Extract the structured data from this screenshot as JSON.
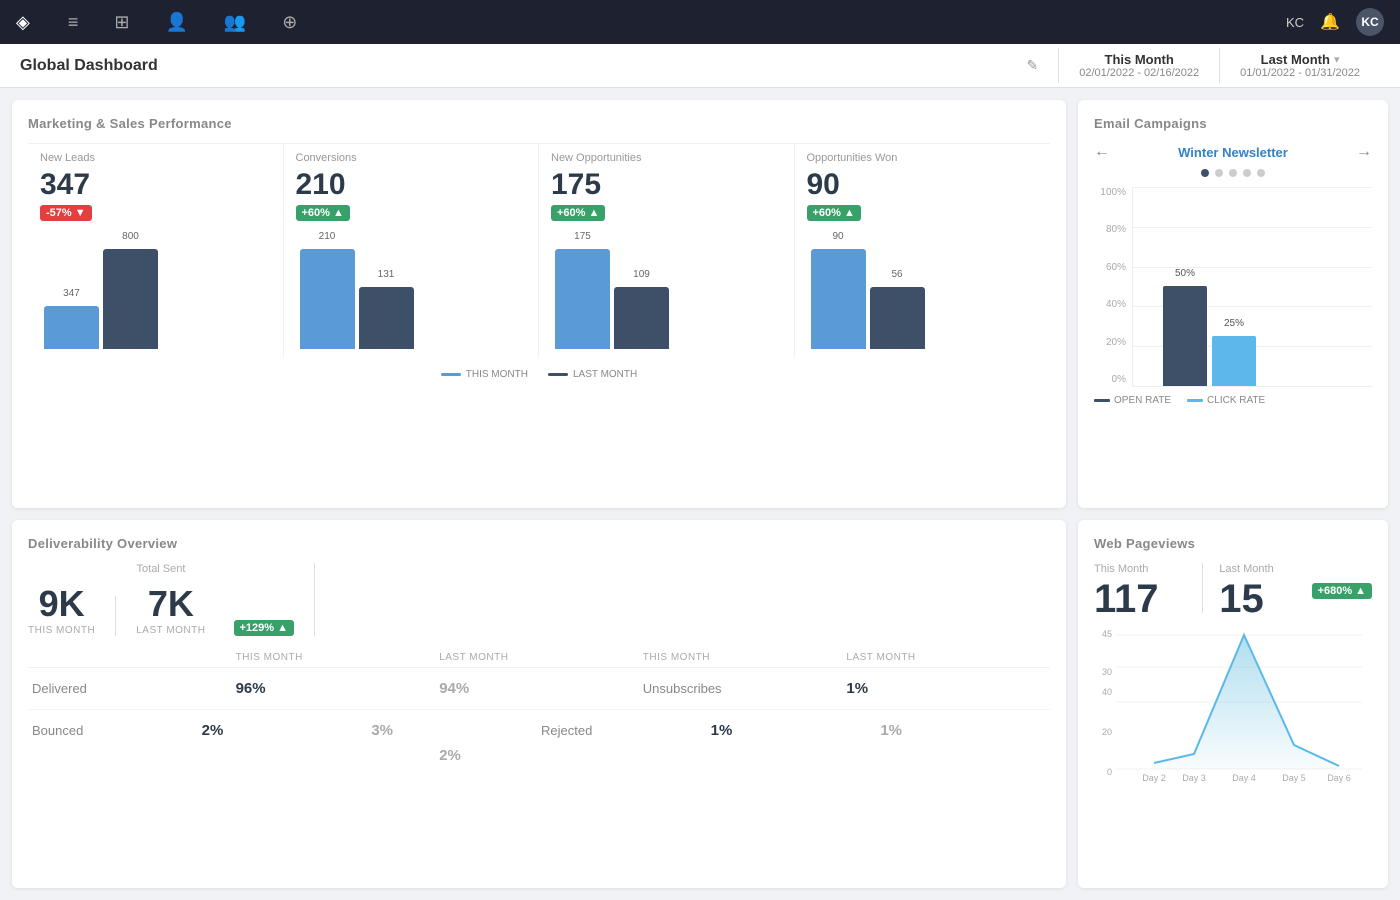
{
  "app": {
    "logo": "◈",
    "nav_icons": [
      "≡",
      "⊞",
      "👤",
      "👥",
      "⊕"
    ],
    "user_initials": "KC",
    "edit_icon": "✎"
  },
  "header": {
    "title": "Global Dashboard",
    "this_month_label": "This Month",
    "this_month_dates": "02/01/2022 - 02/16/2022",
    "last_month_label": "Last Month",
    "last_month_dates": "01/01/2022 - 01/31/2022"
  },
  "marketing": {
    "title": "Marketing & Sales Performance",
    "metrics": [
      {
        "label": "New Leads",
        "value": "347",
        "badge": "-57%",
        "badge_type": "red",
        "this_month_bar": 347,
        "last_month_bar": 800,
        "this_month_label": "347",
        "last_month_label": "800"
      },
      {
        "label": "Conversions",
        "value": "210",
        "badge": "+60%",
        "badge_type": "green",
        "this_month_bar": 210,
        "last_month_bar": 131,
        "this_month_label": "210",
        "last_month_label": "131"
      },
      {
        "label": "New Opportunities",
        "value": "175",
        "badge": "+60%",
        "badge_type": "green",
        "this_month_bar": 175,
        "last_month_bar": 109,
        "this_month_label": "175",
        "last_month_label": "109"
      },
      {
        "label": "Opportunities Won",
        "value": "90",
        "badge": "+60%",
        "badge_type": "green",
        "this_month_bar": 90,
        "last_month_bar": 56,
        "this_month_label": "90",
        "last_month_label": "56"
      }
    ],
    "legend_this_month": "THIS MONTH",
    "legend_last_month": "LAST MONTH"
  },
  "email_campaigns": {
    "title": "Email Campaigns",
    "campaign_name": "Winter Newsletter",
    "open_rate_label": "OPEN RATE",
    "click_rate_label": "CLICK RATE",
    "bars": [
      {
        "open": 50,
        "click": 25,
        "open_label": "50%",
        "click_label": "25%"
      }
    ],
    "y_labels": [
      "100%",
      "80%",
      "60%",
      "40%",
      "20%",
      "0%"
    ],
    "dots": [
      true,
      false,
      false,
      false,
      false
    ]
  },
  "deliverability": {
    "title": "Deliverability Overview",
    "total_sent_label": "Total Sent",
    "this_month_label": "This Month",
    "last_month_label": "Last Month",
    "this_month_value": "9K",
    "last_month_value": "7K",
    "this_month_sub": "THIS MONTH",
    "last_month_sub": "LAST MONTH",
    "badge": "+129%",
    "table_headers": [
      "",
      "THIS MONTH",
      "LAST MONTH",
      "THIS MONTH",
      "LAST MONTH"
    ],
    "rows": [
      {
        "label": "Delivered",
        "tm": "96%",
        "lm": "94%",
        "label2": "Unsubscribes",
        "tm2": "1%",
        "lm2": "2%"
      },
      {
        "label": "Bounced",
        "tm": "2%",
        "lm": "3%",
        "label2": "Rejected",
        "tm2": "1%",
        "lm2": "1%"
      }
    ]
  },
  "pageviews": {
    "title": "Web Pageviews",
    "this_month_label": "This Month",
    "last_month_label": "Last Month",
    "this_month_value": "117",
    "last_month_value": "15",
    "badge": "+680%",
    "chart_days": [
      "Day 2",
      "Day 3",
      "Day 4",
      "Day 5",
      "Day 6"
    ],
    "chart_values": [
      2,
      5,
      45,
      8,
      1
    ],
    "y_labels": [
      "45",
      "30",
      "40",
      "20",
      "0"
    ]
  }
}
